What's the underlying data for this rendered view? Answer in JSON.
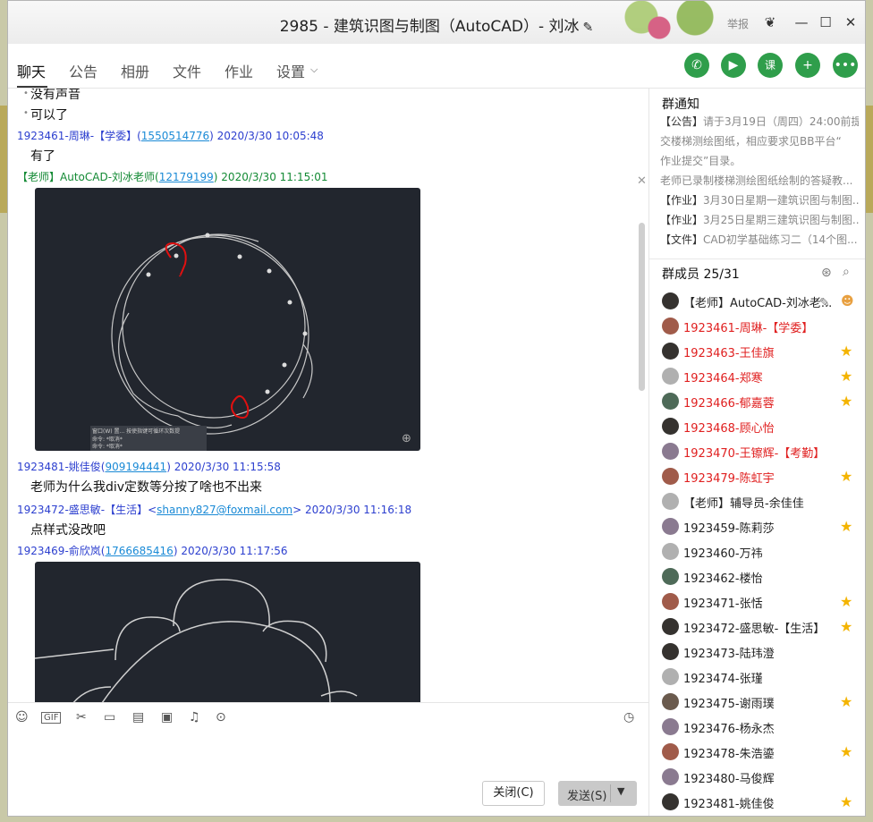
{
  "window": {
    "title": "2985 - 建筑识图与制图（AutoCAD）- 刘冰",
    "report": "举报"
  },
  "tabs": [
    {
      "label": "聊天"
    },
    {
      "label": "公告"
    },
    {
      "label": "相册"
    },
    {
      "label": "文件"
    },
    {
      "label": "作业"
    },
    {
      "label": "设置"
    }
  ],
  "messages": {
    "m0_text": "没有声音",
    "m1_text": "可以了",
    "m2_sender": "1923461-周琳-【学委】",
    "m2_qq": "1550514776",
    "m2_time": "2020/3/30 10:05:48",
    "m2_text": "有了",
    "m3_sender": "【老师】AutoCAD-刘冰老师",
    "m3_qq": "12179199",
    "m3_time": "2020/3/30 11:15:01",
    "m4_sender": "1923481-姚佳俊",
    "m4_qq": "909194441",
    "m4_time": "2020/3/30 11:15:58",
    "m4_text": "老师为什么我div定数等分按了啥也不出来",
    "m5_sender": "1923472-盛思敏-【生活】",
    "m5_email": "shanny827@foxmail.com",
    "m5_time": "2020/3/30 11:16:18",
    "m5_text": "点样式没改吧",
    "m6_sender": "1923469-俞欣岚",
    "m6_qq": "1766685416",
    "m6_time": "2020/3/30 11:17:56",
    "cad_line1": "窗口(W) 置...  按使指键可循环次数提",
    "cad_line2": "命令: *取消*",
    "cad_line3": "命令: *取消*"
  },
  "buttons": {
    "close": "关闭(C)",
    "send": "发送(S)"
  },
  "notice": {
    "title": "群通知",
    "items": [
      {
        "tag": "【公告】",
        "text": "请于3月19日（周四）24:00前提"
      },
      {
        "tag": "",
        "text": "交楼梯测绘图纸，相应要求见BB平台“"
      },
      {
        "tag": "",
        "text": "作业提交”目录。"
      },
      {
        "tag": "",
        "text": "老师已录制楼梯测绘图纸绘制的答疑教..."
      },
      {
        "tag": "【作业】",
        "text": "3月30日星期一建筑识图与制图..."
      },
      {
        "tag": "【作业】",
        "text": "3月25日星期三建筑识图与制图..."
      },
      {
        "tag": "【文件】",
        "text": "CAD初学基础练习二（14个图..."
      }
    ]
  },
  "members": {
    "title": "群成员 25/31",
    "list": [
      {
        "name": "【老师】AutoCAD-刘冰老...",
        "red": false,
        "star": false
      },
      {
        "name": "1923461-周琳-【学委】",
        "red": true,
        "star": false
      },
      {
        "name": "1923463-王佳旗",
        "red": true,
        "star": true
      },
      {
        "name": "1923464-郑寒",
        "red": true,
        "star": true
      },
      {
        "name": "1923466-郁嘉蓉",
        "red": true,
        "star": true
      },
      {
        "name": "1923468-顾心怡",
        "red": true,
        "star": false
      },
      {
        "name": "1923470-王镲辉-【考勤】",
        "red": true,
        "star": false
      },
      {
        "name": "1923479-陈虹宇",
        "red": true,
        "star": true
      },
      {
        "name": "【老师】辅导员-余佳佳",
        "red": false,
        "star": false
      },
      {
        "name": "1923459-陈莉莎",
        "red": false,
        "star": true
      },
      {
        "name": "1923460-万祎",
        "red": false,
        "star": false
      },
      {
        "name": "1923462-楼怡",
        "red": false,
        "star": false
      },
      {
        "name": "1923471-张恬",
        "red": false,
        "star": true
      },
      {
        "name": "1923472-盛思敏-【生活】",
        "red": false,
        "star": true
      },
      {
        "name": "1923473-陆玮澄",
        "red": false,
        "star": false
      },
      {
        "name": "1923474-张瑾",
        "red": false,
        "star": false
      },
      {
        "name": "1923475-谢雨璞",
        "red": false,
        "star": true
      },
      {
        "name": "1923476-杨永杰",
        "red": false,
        "star": false
      },
      {
        "name": "1923478-朱浩鎏",
        "red": false,
        "star": true
      },
      {
        "name": "1923480-马俊辉",
        "red": false,
        "star": false
      },
      {
        "name": "1923481-姚佳俊",
        "red": false,
        "star": true
      }
    ]
  },
  "colors": {
    "accent": "#2f9e4b",
    "red": "#e02020",
    "blue": "#2c3fcf",
    "green": "#138a34",
    "star": "#f4b400"
  }
}
